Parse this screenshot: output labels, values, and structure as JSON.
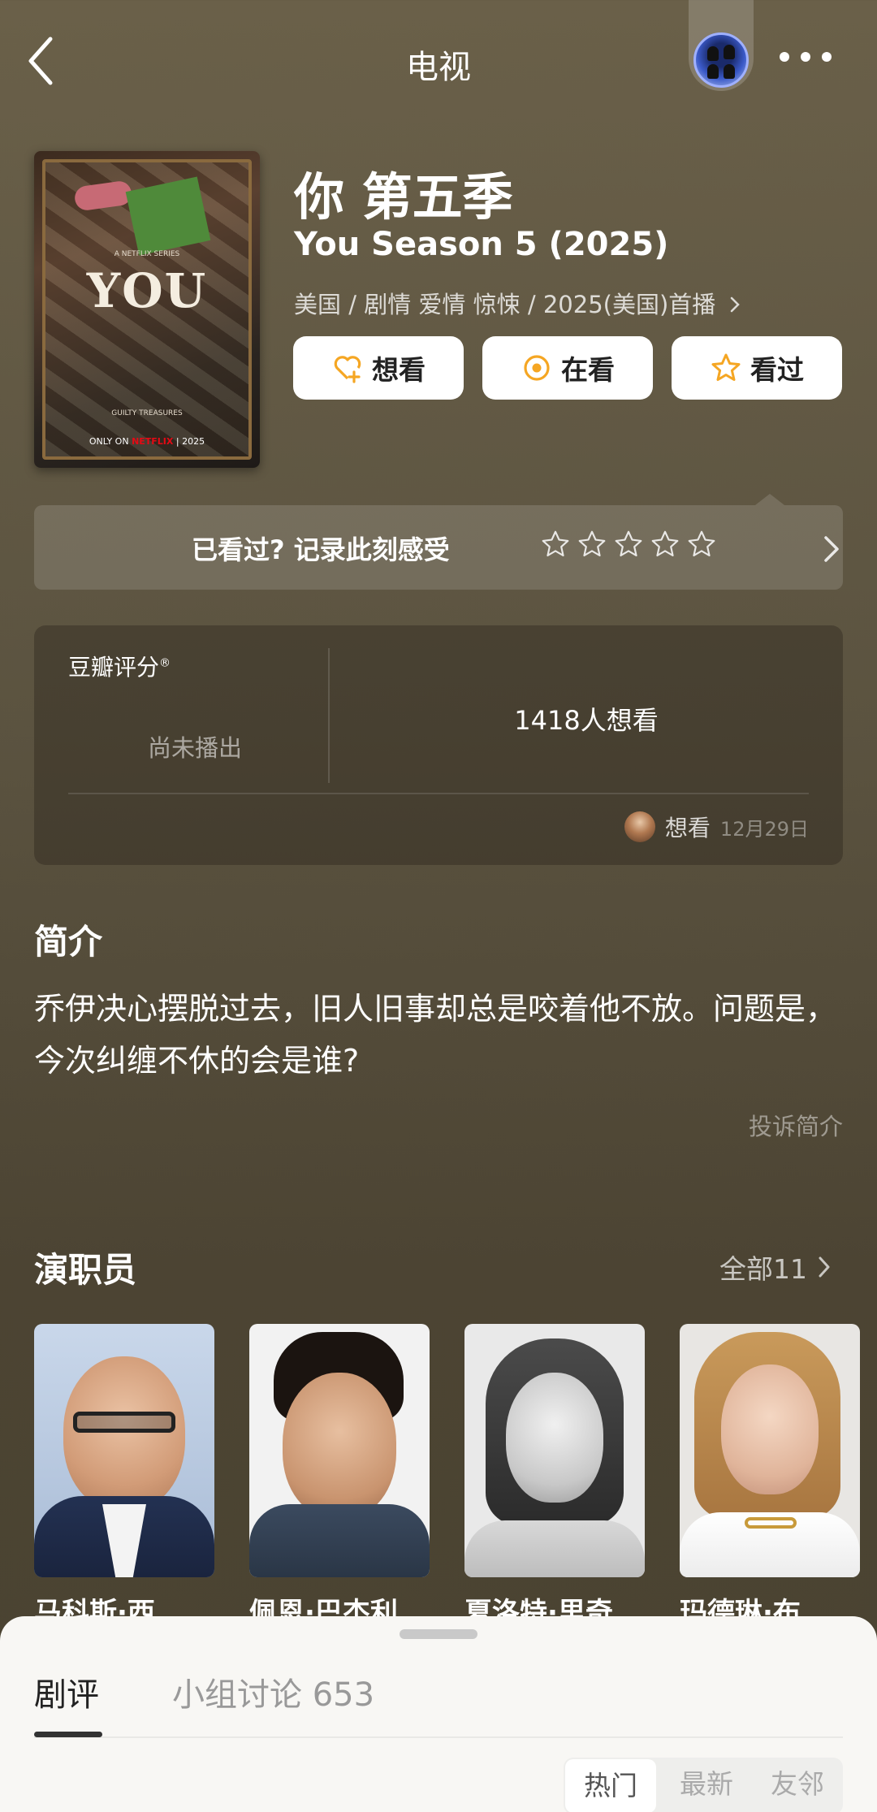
{
  "header": {
    "title": "电视"
  },
  "poster": {
    "series_line": "A NETFLIX SERIES",
    "big_title": "YOU",
    "tagline": "GUILTY TREASURES",
    "bottom_prefix": "ONLY ON",
    "brand": "NETFLIX",
    "year": "2025"
  },
  "title": {
    "cn": "你 第五季",
    "en": "You Season 5 (2025)",
    "meta": "美国 / 剧情 爱情 惊悚 / 2025(美国)首播"
  },
  "actions": {
    "want": "想看",
    "watching": "在看",
    "watched": "看过"
  },
  "record": {
    "prompt": "已看过? 记录此刻感受",
    "stars": 5
  },
  "score": {
    "label": "豆瓣评分",
    "mark": "®",
    "status": "尚未播出",
    "want_count": "1418人想看",
    "friend_status": "想看",
    "friend_date": "12月29日"
  },
  "intro": {
    "title": "简介",
    "text": "乔伊决心摆脱过去，旧人旧事却总是咬着他不放。问题是，今次纠缠不休的会是谁?",
    "report": "投诉简介"
  },
  "cast": {
    "title": "演职员",
    "all": "全部11",
    "members": [
      {
        "name": "马科斯·西…"
      },
      {
        "name": "佩恩·巴杰利"
      },
      {
        "name": "夏洛特·里奇"
      },
      {
        "name": "玛德琳·布…"
      }
    ]
  },
  "sheet": {
    "tab_review": "剧评",
    "tab_group": "小组讨论 653",
    "sort": [
      "热门",
      "最新",
      "友邻"
    ]
  },
  "colors": {
    "accent_orange": "#f5a623",
    "background": "#5b5340"
  }
}
